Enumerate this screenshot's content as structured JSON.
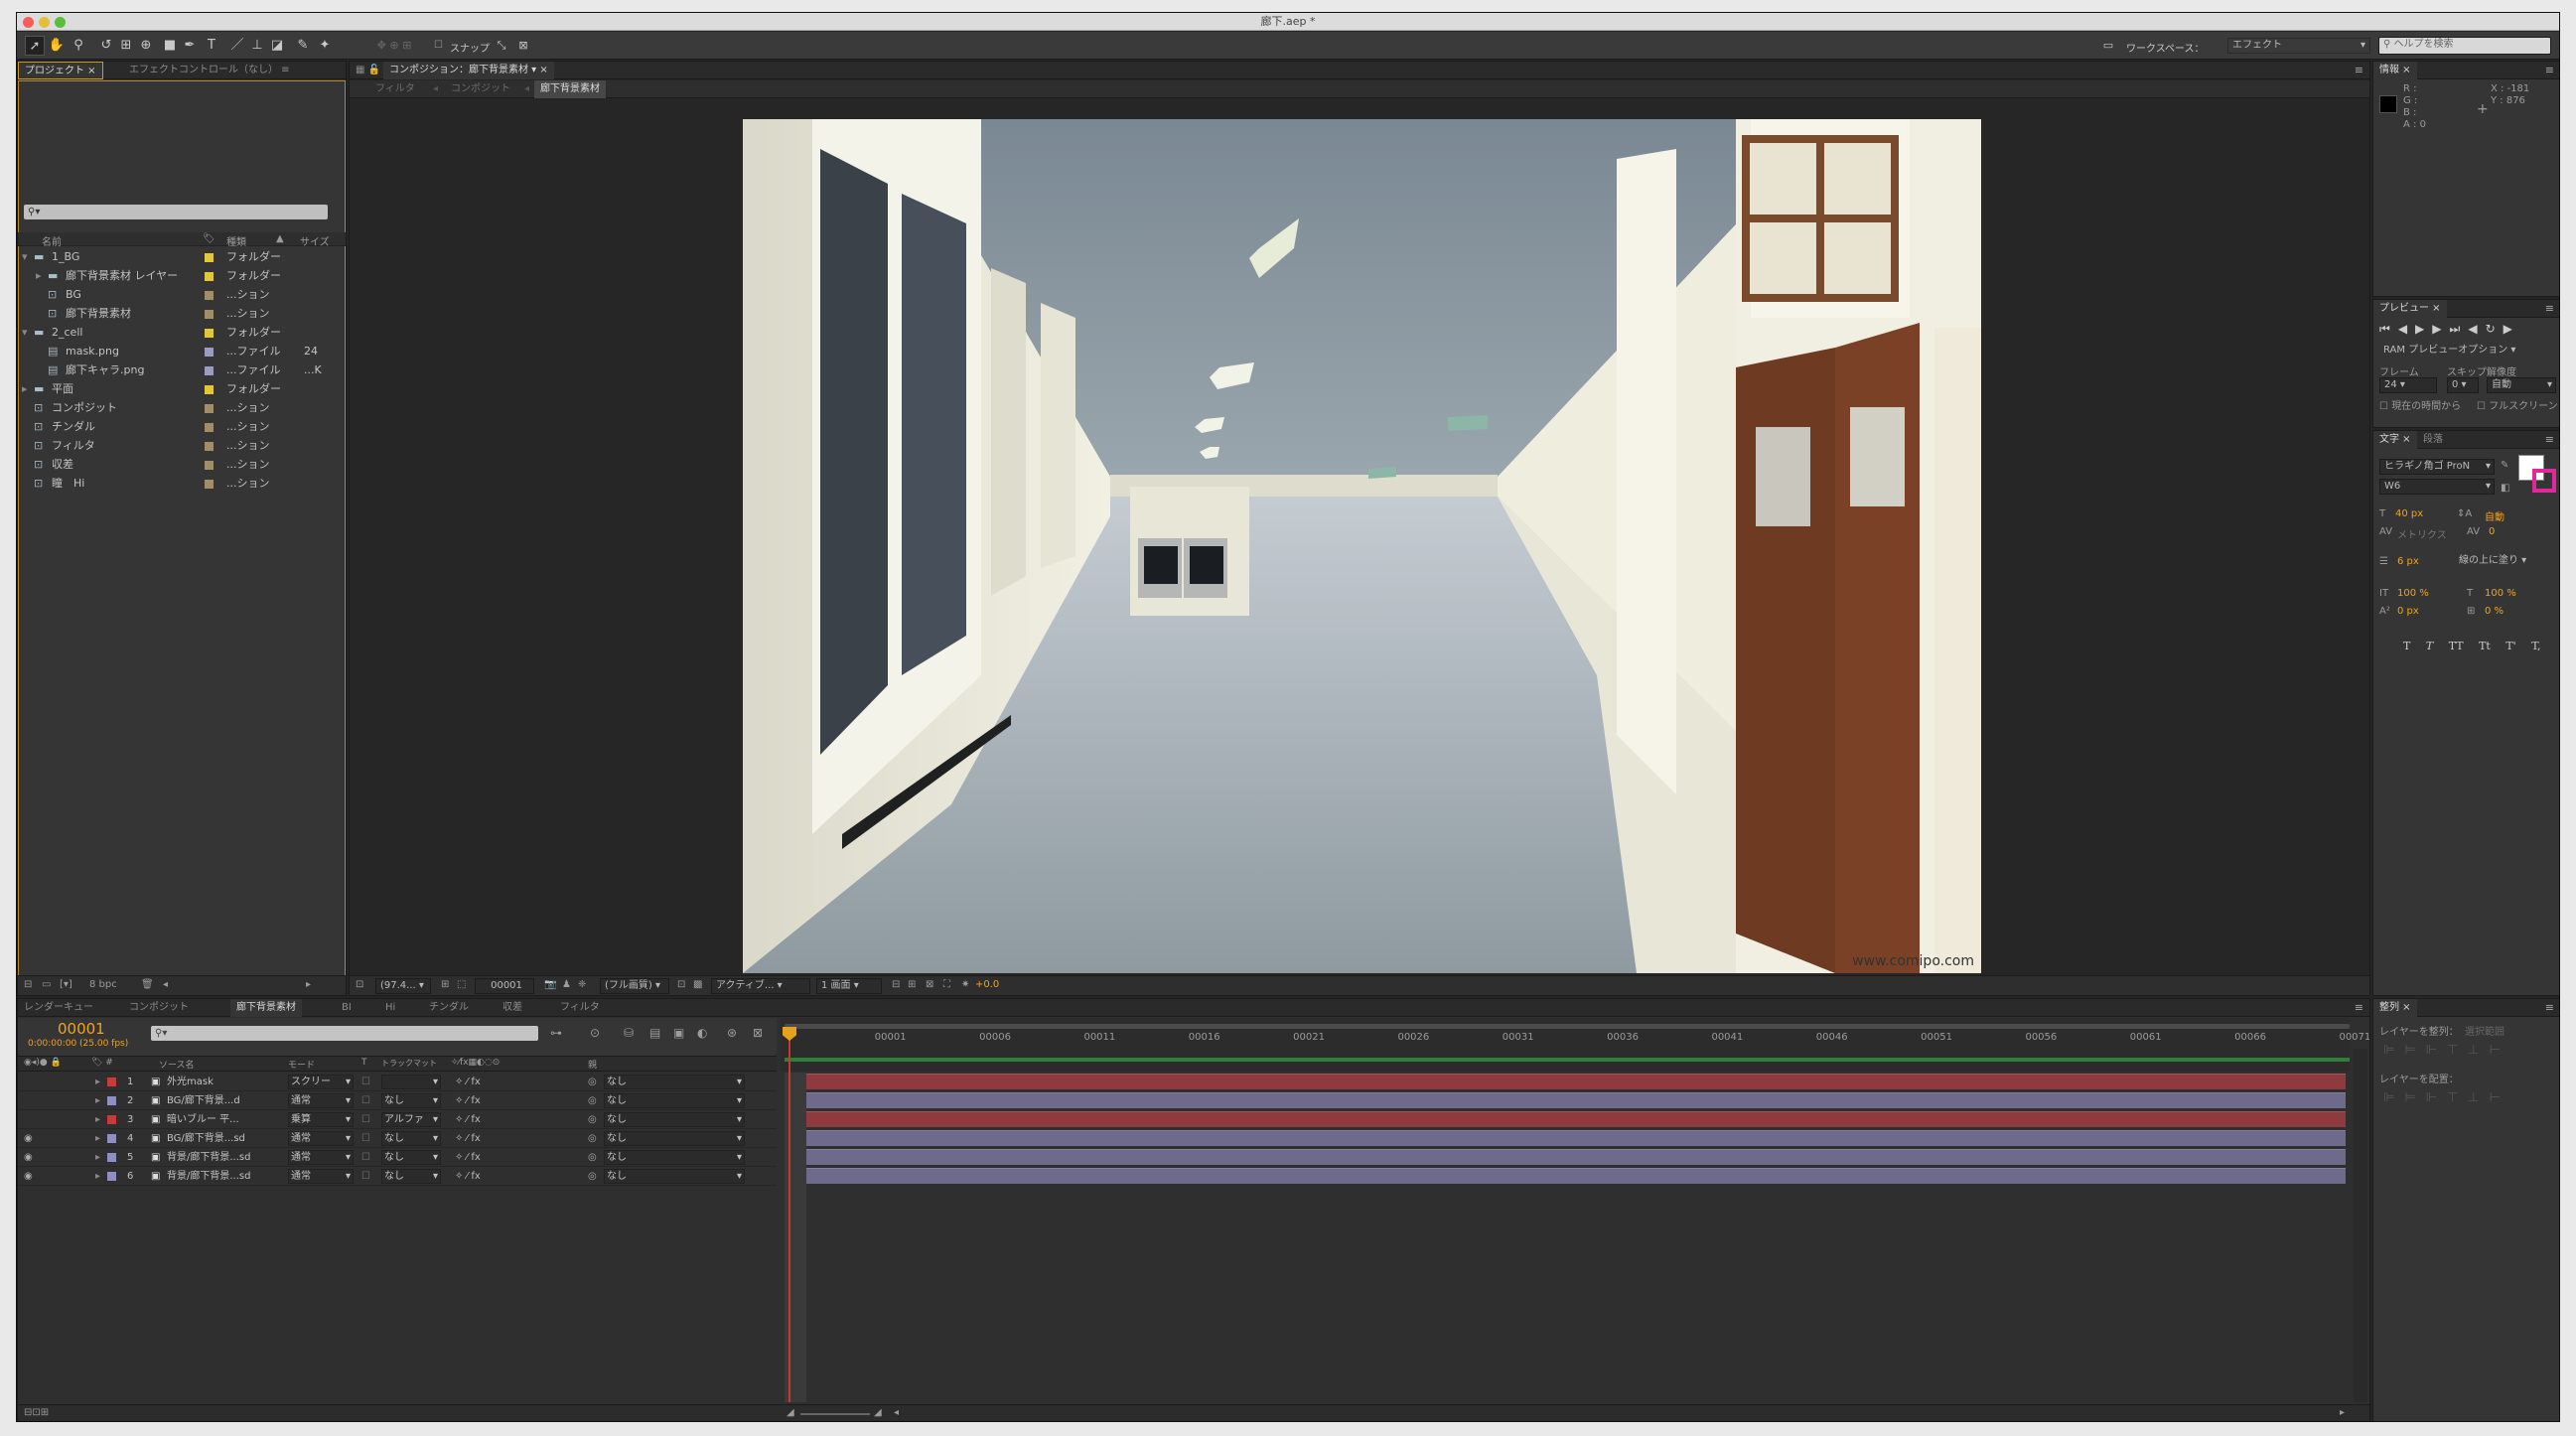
{
  "window": {
    "title": "廊下.aep *"
  },
  "toolbar": {
    "snap_label": "スナップ",
    "workspace_label": "ワークスペース：",
    "workspace_value": "エフェクト",
    "help_placeholder": "ヘルプを検索"
  },
  "project": {
    "tabs": [
      "プロジェクト",
      "エフェクトコントロール（なし）"
    ],
    "search_placeholder": "",
    "columns": {
      "name": "名前",
      "type": "種類",
      "size": "サイズ"
    },
    "items": [
      {
        "name": "1_BG",
        "type": "フォルダー",
        "size": "",
        "color": "#e1c83a",
        "indent": 0,
        "icon": "folder",
        "open": true
      },
      {
        "name": "廊下背景素材 レイヤー",
        "type": "フォルダー",
        "size": "",
        "color": "#e1c83a",
        "indent": 1,
        "icon": "folder",
        "open": false
      },
      {
        "name": "BG",
        "type": "...ション",
        "size": "",
        "color": "#a28c6a",
        "indent": 1,
        "icon": "comp",
        "open": null
      },
      {
        "name": "廊下背景素材",
        "type": "...ション",
        "size": "",
        "color": "#a28c6a",
        "indent": 1,
        "icon": "comp",
        "open": null
      },
      {
        "name": "2_cell",
        "type": "フォルダー",
        "size": "",
        "color": "#e1c83a",
        "indent": 0,
        "icon": "folder",
        "open": true
      },
      {
        "name": "mask.png",
        "type": "...ファイル",
        "size": "24",
        "color": "#9c9cc0",
        "indent": 1,
        "icon": "file",
        "open": null
      },
      {
        "name": "廊下キャラ.png",
        "type": "...ファイル",
        "size": "...K",
        "color": "#9c9cc0",
        "indent": 1,
        "icon": "file",
        "open": null
      },
      {
        "name": "平面",
        "type": "フォルダー",
        "size": "",
        "color": "#e1c83a",
        "indent": 0,
        "icon": "folder",
        "open": false
      },
      {
        "name": "コンポジット",
        "type": "...ション",
        "size": "",
        "color": "#a28c6a",
        "indent": 0,
        "icon": "comp",
        "open": null
      },
      {
        "name": "チンダル",
        "type": "...ション",
        "size": "",
        "color": "#a28c6a",
        "indent": 0,
        "icon": "comp",
        "open": null
      },
      {
        "name": "フィルタ",
        "type": "...ション",
        "size": "",
        "color": "#a28c6a",
        "indent": 0,
        "icon": "comp",
        "open": null
      },
      {
        "name": "収差",
        "type": "...ション",
        "size": "",
        "color": "#a28c6a",
        "indent": 0,
        "icon": "comp",
        "open": null
      },
      {
        "name": "瞳　Hi",
        "type": "...ション",
        "size": "",
        "color": "#a28c6a",
        "indent": 0,
        "icon": "comp",
        "open": null
      }
    ],
    "bpc": "8 bpc"
  },
  "composition": {
    "header": "コンポジション：廊下背景素材",
    "breadcrumbs": [
      "フィルタ",
      "コンポジット",
      "廊下背景素材"
    ],
    "watermark": "www.comipo.com",
    "viewer": {
      "zoom": "(97.4...",
      "timecode": "00001",
      "resolution": "(フル画質)",
      "camera": "アクティブ...",
      "views": "1 画面",
      "exposure": "+0.0"
    }
  },
  "info": {
    "title": "情報",
    "r": "R :",
    "g": "G :",
    "b": "B :",
    "a": "A : 0",
    "x": "X : -181",
    "y": "Y : 876"
  },
  "preview": {
    "title": "プレビュー",
    "ram_option": "RAM プレビューオプション",
    "frame_label": "フレーム",
    "skip_label": "スキップ",
    "res_label": "解像度",
    "frame_value": "24",
    "skip_value": "0",
    "res_value": "自動",
    "from_current": "現在の時間から",
    "fullscreen": "フルスクリーン"
  },
  "character": {
    "tabs": [
      "文字",
      "段落"
    ],
    "font": "ヒラギノ角ゴ ProN",
    "weight": "W6",
    "size": "40 px",
    "leading": "自動",
    "kerning": "メトリクス",
    "tracking": "0",
    "stroke": "6 px",
    "stroke_mode": "線の上に塗り",
    "vscale": "100 %",
    "hscale": "100 %",
    "baseline": "0 px",
    "tsume": "0 %",
    "styles": [
      "T",
      "T",
      "TT",
      "Tt",
      "T'",
      "T,"
    ],
    "fill_color": "#ffffff",
    "stroke_color": "#e0289a"
  },
  "align": {
    "title": "整列",
    "align_to_label": "レイヤーを整列：",
    "align_to_value": "選択範囲",
    "distribute_label": "レイヤーを配置："
  },
  "timeline": {
    "tabs": [
      "レンダーキュー",
      "コンポジット",
      "廊下背景素材",
      "BI",
      "Hi",
      "チンダル",
      "収差",
      "フィルタ"
    ],
    "timecode": "00001",
    "timecode_sub": "0:00:00:00 (25.00 fps)",
    "columns": {
      "source": "ソース名",
      "mode": "モード",
      "t": "T",
      "trkmat": "トラックマット",
      "parent": "親"
    },
    "ruler": [
      "00001",
      "00006",
      "00011",
      "00016",
      "00021",
      "00026",
      "00031",
      "00036",
      "00041",
      "00046",
      "00051",
      "00056",
      "00061",
      "00066",
      "00071"
    ],
    "layers": [
      {
        "num": "1",
        "name": "外光mask",
        "mode": "スクリー",
        "trkmat": "",
        "parent": "なし",
        "label": "#c73b3b",
        "bar": "#8f3a3e",
        "eye": false
      },
      {
        "num": "2",
        "name": "BG/廊下背景...d",
        "mode": "通常",
        "trkmat": "なし",
        "parent": "なし",
        "label": "#8f8fc4",
        "bar": "#6d6a8c",
        "eye": false
      },
      {
        "num": "3",
        "name": "暗いブルー 平...",
        "mode": "乗算",
        "trkmat": "アルファ",
        "parent": "なし",
        "label": "#c73b3b",
        "bar": "#8f3a3e",
        "eye": false
      },
      {
        "num": "4",
        "name": "BG/廊下背景...sd",
        "mode": "通常",
        "trkmat": "なし",
        "parent": "なし",
        "label": "#8f8fc4",
        "bar": "#6d6a8c",
        "eye": true
      },
      {
        "num": "5",
        "name": "背景/廊下背景...sd",
        "mode": "通常",
        "trkmat": "なし",
        "parent": "なし",
        "label": "#8f8fc4",
        "bar": "#6d6a8c",
        "eye": true
      },
      {
        "num": "6",
        "name": "背景/廊下背景...sd",
        "mode": "通常",
        "trkmat": "なし",
        "parent": "なし",
        "label": "#8f8fc4",
        "bar": "#6d6a8c",
        "eye": true
      }
    ]
  }
}
